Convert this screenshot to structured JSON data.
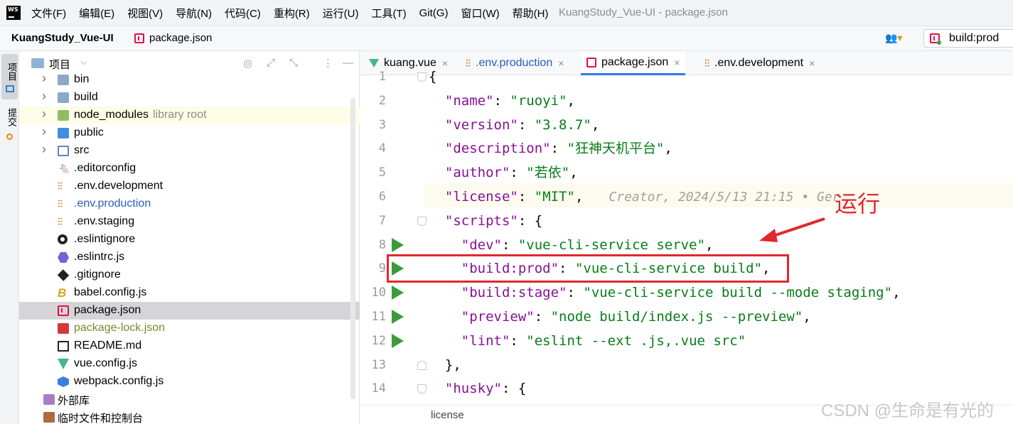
{
  "app": {
    "logo": "WS",
    "window_title": "KuangStudy_Vue-UI - package.json"
  },
  "menu": [
    "文件(F)",
    "编辑(E)",
    "视图(V)",
    "导航(N)",
    "代码(C)",
    "重构(R)",
    "运行(U)",
    "工具(T)",
    "Git(G)",
    "窗口(W)",
    "帮助(H)"
  ],
  "nav": {
    "project": "KuangStudy_Vue-UI",
    "file": "package.json",
    "run_config": "build:prod"
  },
  "left_strip": {
    "project_label": "项目",
    "commit_label": "提交"
  },
  "project_panel": {
    "title": "项目",
    "tree": [
      {
        "label": "bin",
        "hint": "",
        "icon": "folder-icon",
        "kind": "ic-folder",
        "arrow": true,
        "color": "#000000"
      },
      {
        "label": "build",
        "hint": "",
        "icon": "folder-icon",
        "kind": "ic-folder",
        "arrow": true,
        "color": "#000000"
      },
      {
        "label": "node_modules",
        "hint": "library root",
        "icon": "library-folder-icon",
        "kind": "ic-folder-green",
        "arrow": true,
        "color": "#000000"
      },
      {
        "label": "public",
        "hint": "",
        "icon": "web-folder-icon",
        "kind": "ic-folder-blue",
        "arrow": true,
        "color": "#000000"
      },
      {
        "label": "src",
        "hint": "",
        "icon": "source-folder-icon",
        "kind": "ic-folder-src",
        "arrow": true,
        "color": "#000000"
      },
      {
        "label": ".editorconfig",
        "hint": "",
        "icon": "editorconfig-icon",
        "kind": "ic-cat",
        "glyph": "🐁",
        "arrow": false,
        "color": "#000000"
      },
      {
        "label": ".env.development",
        "hint": "",
        "icon": "env-file-icon",
        "kind": "ic-env",
        "glyph": "⫶⫶",
        "arrow": false,
        "color": "#000000"
      },
      {
        "label": ".env.production",
        "hint": "",
        "icon": "env-file-icon",
        "kind": "ic-env",
        "glyph": "⫶⫶",
        "arrow": false,
        "color": "#2a5cb8"
      },
      {
        "label": ".env.staging",
        "hint": "",
        "icon": "env-file-icon",
        "kind": "ic-env",
        "glyph": "⫶⫶",
        "arrow": false,
        "color": "#000000"
      },
      {
        "label": ".eslintignore",
        "hint": "",
        "icon": "eslintignore-icon",
        "kind": "ic-circle",
        "arrow": false,
        "color": "#000000"
      },
      {
        "label": ".eslintrc.js",
        "hint": "",
        "icon": "eslint-icon",
        "kind": "ic-hex",
        "arrow": false,
        "color": "#000000"
      },
      {
        "label": ".gitignore",
        "hint": "",
        "icon": "git-icon",
        "kind": "ic-diamond",
        "arrow": false,
        "color": "#000000"
      },
      {
        "label": "babel.config.js",
        "hint": "",
        "icon": "babel-icon",
        "kind": "ic-babel",
        "glyph": "B",
        "arrow": false,
        "color": "#000000"
      },
      {
        "label": "package.json",
        "hint": "",
        "icon": "json-file-icon",
        "kind": "json",
        "arrow": false,
        "color": "#000000",
        "selected": true
      },
      {
        "label": "package-lock.json",
        "hint": "",
        "icon": "lock-file-icon",
        "kind": "ic-lock",
        "arrow": false,
        "color": "#7a8a2a"
      },
      {
        "label": "README.md",
        "hint": "",
        "icon": "markdown-icon",
        "kind": "ic-readme",
        "arrow": false,
        "color": "#000000"
      },
      {
        "label": "vue.config.js",
        "hint": "",
        "icon": "vue-icon",
        "kind": "ic-vue",
        "arrow": false,
        "color": "#000000"
      },
      {
        "label": "webpack.config.js",
        "hint": "",
        "icon": "webpack-icon",
        "kind": "ic-webpack",
        "arrow": false,
        "color": "#000000"
      }
    ],
    "external_libs": "外部库",
    "scratches": "临时文件和控制台"
  },
  "tabs": [
    {
      "label": "kuang.vue",
      "icon": "vue-icon",
      "close": "×",
      "active": false,
      "blue": false
    },
    {
      "label": ".env.production",
      "icon": "env-file-icon",
      "close": "×",
      "active": false,
      "blue": true
    },
    {
      "label": "package.json",
      "icon": "json-file-icon",
      "close": "×",
      "active": true,
      "blue": false
    },
    {
      "label": ".env.development",
      "icon": "env-file-icon",
      "close": "×",
      "active": false,
      "blue": false
    }
  ],
  "code": {
    "line_numbers": [
      "1",
      "2",
      "3",
      "4",
      "5",
      "6",
      "7",
      "8",
      "9",
      "10",
      "11",
      "12",
      "13",
      "14"
    ],
    "lines": [
      [
        [
          "p",
          "{"
        ]
      ],
      [
        [
          "p",
          "  "
        ],
        [
          "k",
          "\"name\""
        ],
        [
          "p",
          ": "
        ],
        [
          "s",
          "\"ruoyi\""
        ],
        [
          "p",
          ","
        ]
      ],
      [
        [
          "p",
          "  "
        ],
        [
          "k",
          "\"version\""
        ],
        [
          "p",
          ": "
        ],
        [
          "s",
          "\"3.8.7\""
        ],
        [
          "p",
          ","
        ]
      ],
      [
        [
          "p",
          "  "
        ],
        [
          "k",
          "\"description\""
        ],
        [
          "p",
          ": "
        ],
        [
          "s",
          "\"狂神天机平台\""
        ],
        [
          "p",
          ","
        ]
      ],
      [
        [
          "p",
          "  "
        ],
        [
          "k",
          "\"author\""
        ],
        [
          "p",
          ": "
        ],
        [
          "s",
          "\"若依\""
        ],
        [
          "p",
          ","
        ]
      ],
      [
        [
          "p",
          "  "
        ],
        [
          "k",
          "\"license\""
        ],
        [
          "p",
          ": "
        ],
        [
          "s",
          "\"MIT\""
        ],
        [
          "p",
          ","
        ]
      ],
      [
        [
          "p",
          "  "
        ],
        [
          "k",
          "\"scripts\""
        ],
        [
          "p",
          ": {"
        ]
      ],
      [
        [
          "p",
          "    "
        ],
        [
          "k",
          "\"dev\""
        ],
        [
          "p",
          ": "
        ],
        [
          "s",
          "\"vue-cli-service serve\""
        ],
        [
          "p",
          ","
        ]
      ],
      [
        [
          "p",
          "    "
        ],
        [
          "k",
          "\"build:prod\""
        ],
        [
          "p",
          ": "
        ],
        [
          "s",
          "\"vue-cli-service build\""
        ],
        [
          "p",
          ","
        ]
      ],
      [
        [
          "p",
          "    "
        ],
        [
          "k",
          "\"build:stage\""
        ],
        [
          "p",
          ": "
        ],
        [
          "s",
          "\"vue-cli-service build --mode staging\""
        ],
        [
          "p",
          ","
        ]
      ],
      [
        [
          "p",
          "    "
        ],
        [
          "k",
          "\"preview\""
        ],
        [
          "p",
          ": "
        ],
        [
          "s",
          "\"node build/index.js --preview\""
        ],
        [
          "p",
          ","
        ]
      ],
      [
        [
          "p",
          "    "
        ],
        [
          "k",
          "\"lint\""
        ],
        [
          "p",
          ": "
        ],
        [
          "s",
          "\"eslint --ext .js,.vue src\""
        ]
      ],
      [
        [
          "p",
          "  },"
        ]
      ],
      [
        [
          "p",
          "  "
        ],
        [
          "k",
          "\"husky\""
        ],
        [
          "p",
          ": {"
        ]
      ]
    ],
    "run_lines": [
      8,
      9,
      10,
      11,
      12
    ],
    "inlay_blame": "Creator, 2024/5/13 21:15 • Ger"
  },
  "annotation": {
    "text": "运行",
    "color": "#e0282e"
  },
  "breadcrumb": "license",
  "watermark": "CSDN @生命是有光的"
}
